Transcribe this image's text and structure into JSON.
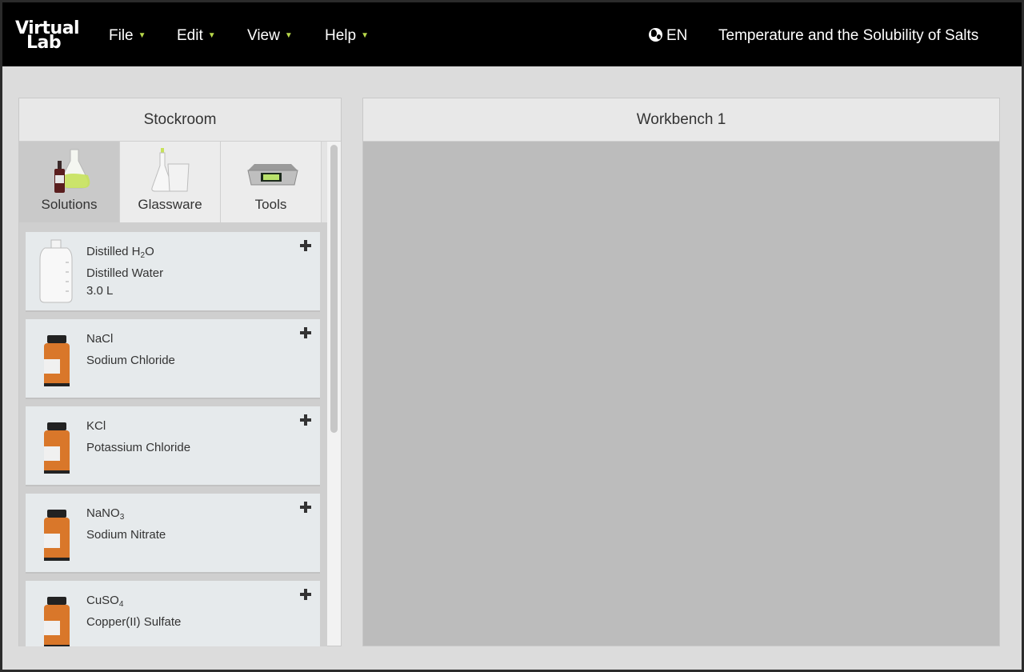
{
  "header": {
    "logo": {
      "line1": "Virtual",
      "line2": "Lab"
    },
    "menus": [
      {
        "label": "File"
      },
      {
        "label": "Edit"
      },
      {
        "label": "View"
      },
      {
        "label": "Help"
      }
    ],
    "language": "EN",
    "experiment_title": "Temperature and the Solubility of Salts"
  },
  "stockroom": {
    "title": "Stockroom",
    "tabs": [
      {
        "label": "Solutions",
        "icon": "solutions-icon",
        "active": true
      },
      {
        "label": "Glassware",
        "icon": "glassware-icon",
        "active": false
      },
      {
        "label": "Tools",
        "icon": "scale-icon",
        "active": false
      }
    ],
    "items": [
      {
        "formula": "Distilled H",
        "formula_sub": "2",
        "formula_tail": "O",
        "name": "Distilled Water",
        "amount": "3.0 L",
        "icon": "water-jug-icon"
      },
      {
        "formula": "NaCl",
        "formula_sub": "",
        "formula_tail": "",
        "name": "Sodium Chloride",
        "icon": "reagent-bottle-icon"
      },
      {
        "formula": "KCl",
        "formula_sub": "",
        "formula_tail": "",
        "name": "Potassium Chloride",
        "icon": "reagent-bottle-icon"
      },
      {
        "formula": "NaNO",
        "formula_sub": "3",
        "formula_tail": "",
        "name": "Sodium Nitrate",
        "icon": "reagent-bottle-icon"
      },
      {
        "formula": "CuSO",
        "formula_sub": "4",
        "formula_tail": "",
        "name": "Copper(II) Sulfate",
        "icon": "reagent-bottle-icon"
      }
    ]
  },
  "workbench": {
    "title": "Workbench 1"
  },
  "colors": {
    "menu_caret": "#b8d84a",
    "bottle": "#d9772a",
    "workbench_bg": "#bcbcbc"
  }
}
